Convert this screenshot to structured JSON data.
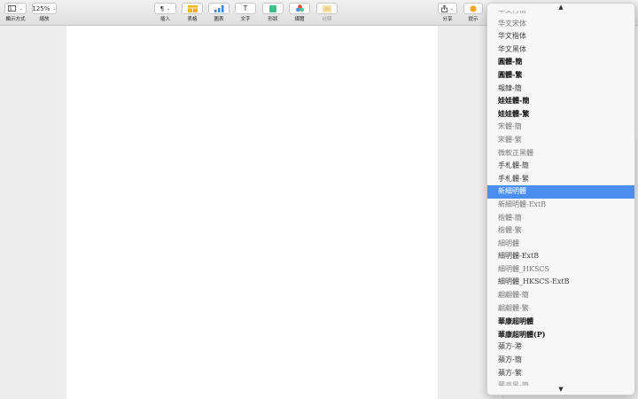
{
  "toolbar": {
    "view": {
      "label": "顯示方式"
    },
    "zoom": {
      "value": "125%",
      "label": "縮放"
    },
    "insert": {
      "icon": "¶",
      "label": "插入"
    },
    "table": {
      "label": "表格"
    },
    "chart": {
      "label": "圖表"
    },
    "text": {
      "icon": "T",
      "label": "文字"
    },
    "shape": {
      "label": "形狀"
    },
    "media": {
      "label": "媒體"
    },
    "comment": {
      "label": "註解"
    },
    "share": {
      "label": "分享"
    },
    "tips": {
      "label": "提示"
    }
  },
  "colors": {
    "accent": "#4a8ef0",
    "shape": "#3dbf8a",
    "table": "#f2b51e",
    "chart": "#3d86d8",
    "tip": "#f5a623"
  },
  "font_menu": {
    "scroll_up": "▲",
    "scroll_down": "▼",
    "items": [
      {
        "label": "华文行楷"
      },
      {
        "label": "华文宋体"
      },
      {
        "label": "华文楷体"
      },
      {
        "label": "华文黑体"
      },
      {
        "label": "圓體-簡"
      },
      {
        "label": "圓體-繁"
      },
      {
        "label": "報隸-簡"
      },
      {
        "label": "娃娃體-簡"
      },
      {
        "label": "娃娃體-繁"
      },
      {
        "label": "宋體-簡"
      },
      {
        "label": "宋體-繁"
      },
      {
        "label": "微軟正黑體"
      },
      {
        "label": "手札體-簡"
      },
      {
        "label": "手札體-繁"
      },
      {
        "label": "新細明體"
      },
      {
        "label": "新細明體-ExtB"
      },
      {
        "label": "楷體-簡"
      },
      {
        "label": "楷體-繁"
      },
      {
        "label": "細明體"
      },
      {
        "label": "細明體-ExtB"
      },
      {
        "label": "細明體_HKSCS"
      },
      {
        "label": "細明體_HKSCS-ExtB"
      },
      {
        "label": "翩翩體-簡"
      },
      {
        "label": "翩翩體-繁"
      },
      {
        "label": "華康超明體"
      },
      {
        "label": "華康超明體(P)"
      },
      {
        "label": "蘋方-港"
      },
      {
        "label": "蘋方-簡"
      },
      {
        "label": "蘋方-繁"
      },
      {
        "label": "蘭亭黑-簡"
      }
    ],
    "selected": "新細明體"
  }
}
